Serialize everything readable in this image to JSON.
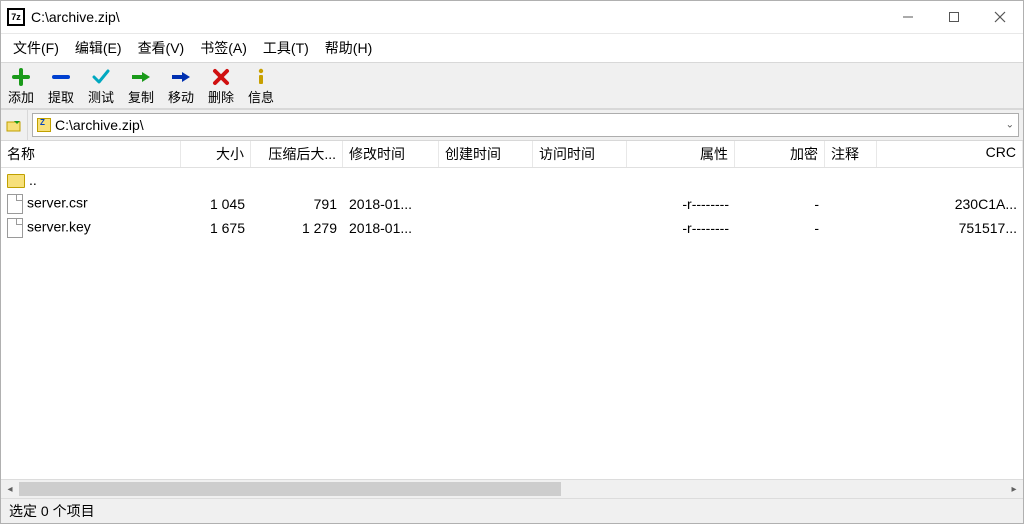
{
  "title": "C:\\archive.zip\\",
  "menu": {
    "items": [
      "文件(F)",
      "编辑(E)",
      "查看(V)",
      "书签(A)",
      "工具(T)",
      "帮助(H)"
    ]
  },
  "toolbar": {
    "items": [
      {
        "id": "add",
        "label": "添加"
      },
      {
        "id": "extract",
        "label": "提取"
      },
      {
        "id": "test",
        "label": "测试"
      },
      {
        "id": "copy",
        "label": "复制"
      },
      {
        "id": "move",
        "label": "移动"
      },
      {
        "id": "delete",
        "label": "删除"
      },
      {
        "id": "info",
        "label": "信息"
      }
    ]
  },
  "address": {
    "path": "C:\\archive.zip\\"
  },
  "columns": {
    "name": "名称",
    "size": "大小",
    "packed": "压缩后大...",
    "mtime": "修改时间",
    "ctime": "创建时间",
    "atime": "访问时间",
    "attr": "属性",
    "enc": "加密",
    "comm": "注释",
    "crc": "CRC"
  },
  "parent_row": {
    "name": ".."
  },
  "files": [
    {
      "name": "server.csr",
      "size": "1 045",
      "packed": "791",
      "mtime": "2018-01...",
      "ctime": "",
      "atime": "",
      "attr": "-r--------",
      "enc": "-",
      "comm": "",
      "crc": "230C1A..."
    },
    {
      "name": "server.key",
      "size": "1 675",
      "packed": "1 279",
      "mtime": "2018-01...",
      "ctime": "",
      "atime": "",
      "attr": "-r--------",
      "enc": "-",
      "comm": "",
      "crc": "751517..."
    }
  ],
  "status": "选定 0 个项目"
}
